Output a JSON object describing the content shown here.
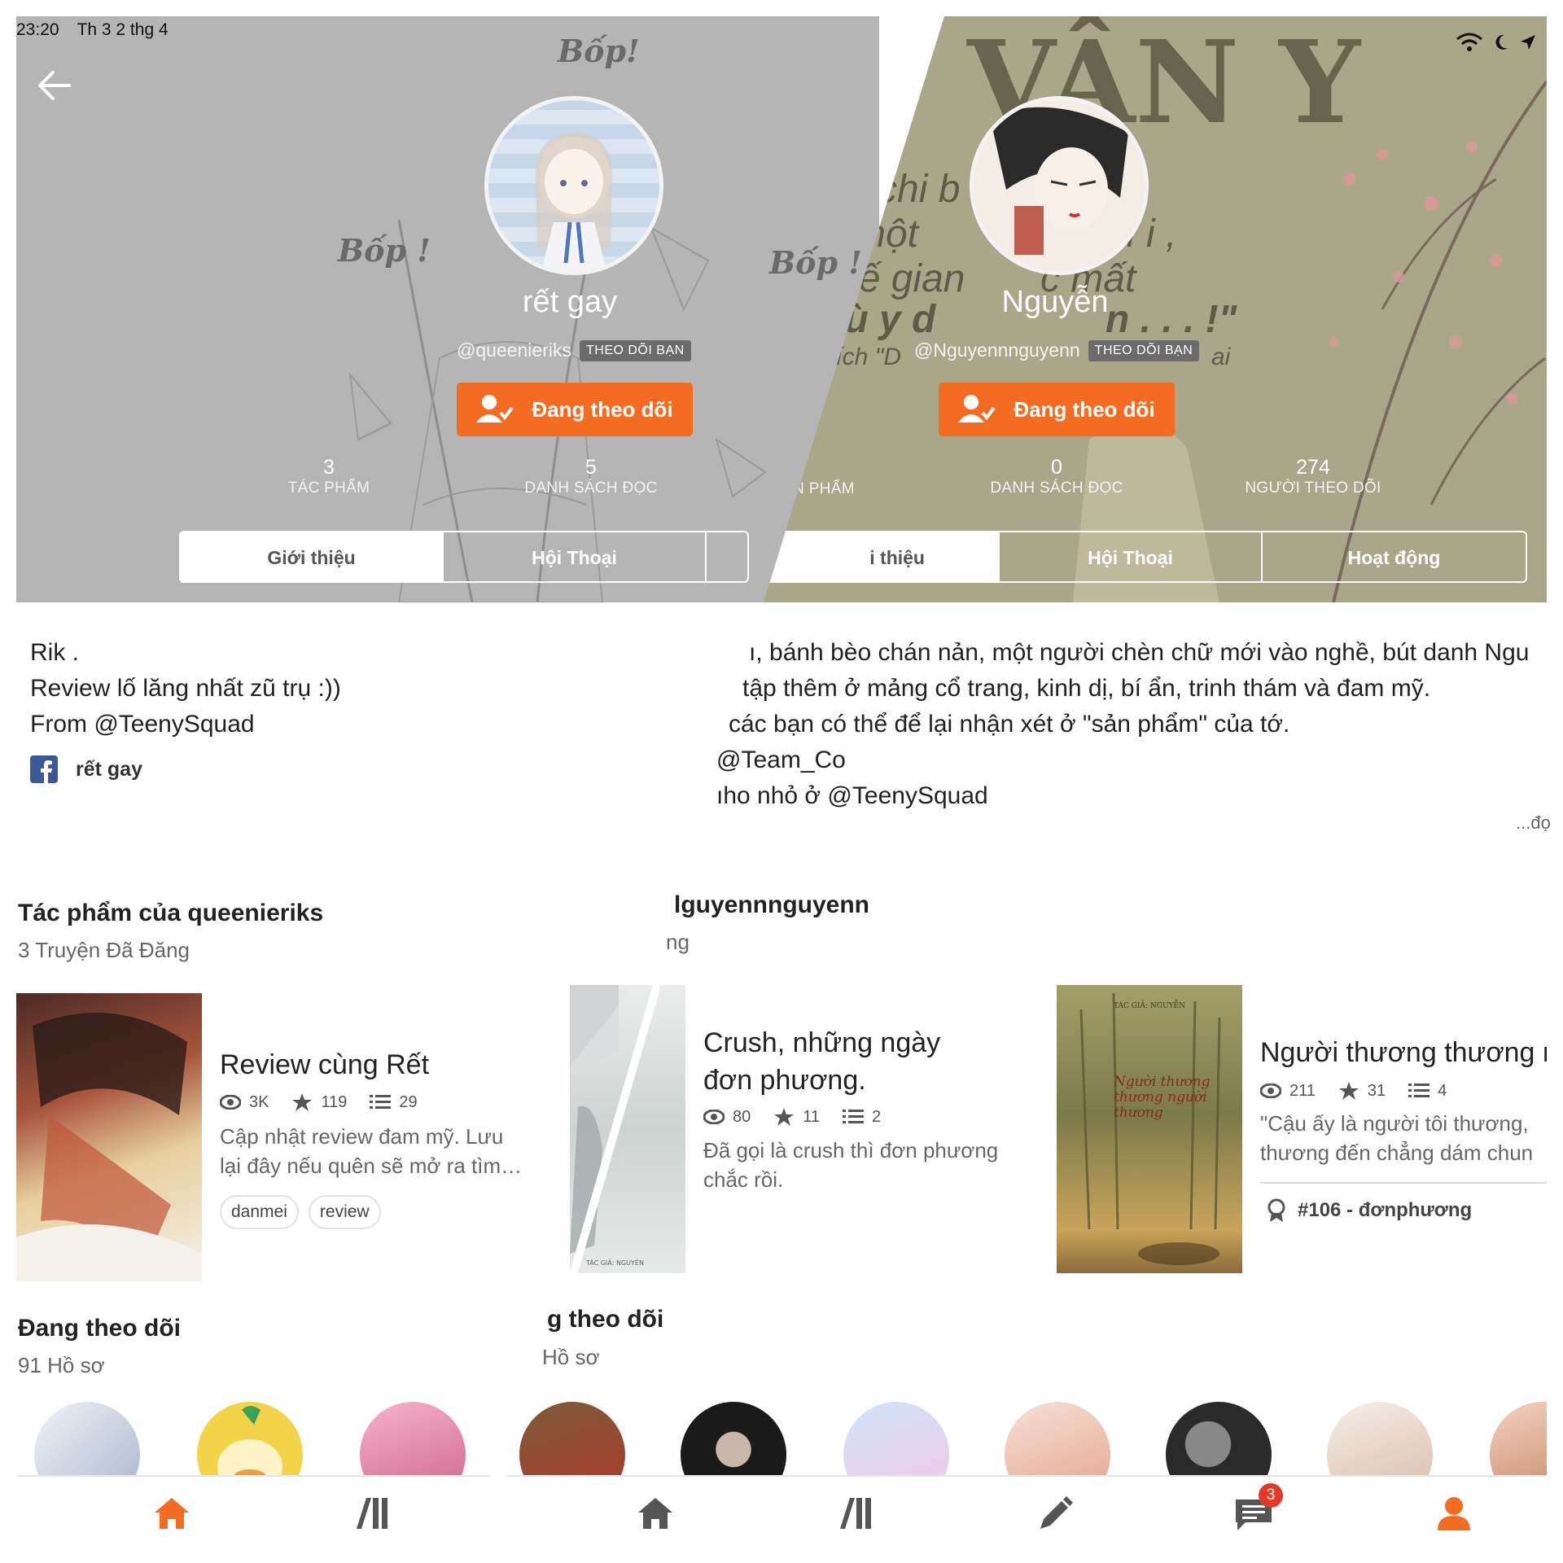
{
  "status_bar": {
    "time": "23:20",
    "date": "Th 3 2 thg 4"
  },
  "left": {
    "header_bg_text": [
      "Bốp!",
      "Bốp !",
      "Bốp !"
    ],
    "display_name": "rết gay",
    "handle": "@queenieriks",
    "badge": "THEO DÕI BẠN",
    "follow_button": "Đang theo dõi",
    "stats": [
      {
        "value": "3",
        "label": "TÁC PHẨM"
      },
      {
        "value": "5",
        "label": "DANH SÁCH ĐỌC"
      }
    ],
    "tabs": [
      "Giới thiệu",
      "Hội Thoại"
    ],
    "bio": [
      "Rik .",
      "Review lố lăng nhất zũ trụ :))",
      "From @TeenySquad"
    ],
    "facebook_name": "rết gay",
    "works_title": "Tác phẩm của queenieriks",
    "works_sub": "3 Truyện Đã Đăng",
    "story": {
      "title": "Review cùng Rết",
      "views": "3K",
      "votes": "119",
      "parts": "29",
      "description": [
        "Cập nhật review đam mỹ. Lưu",
        "lại đây nếu quên sẽ mở ra tìm…"
      ],
      "tags": [
        "danmei",
        "review"
      ]
    },
    "following_title": "Đang theo dõi",
    "following_sub": "91 Hồ sơ"
  },
  "right": {
    "header_bg_text": [
      "VÂN Y",
      "chi b",
      "một",
      "ù i ,",
      "hế gian",
      "c mất",
      "t ù y d",
      "n . . . !\"",
      "trích \"D",
      "ai"
    ],
    "display_name": "Nguyễn",
    "handle": "@Nguyennnguyenn",
    "badge": "THEO DÕI BẠN",
    "follow_button": "Đang theo dõi",
    "stats": [
      {
        "value": "",
        "label": "N  PHẨM"
      },
      {
        "value": "0",
        "label": "DANH SÁCH ĐỌC"
      },
      {
        "value": "274",
        "label": "NGƯỜI THEO DÕI"
      }
    ],
    "tabs": [
      "i thiệu",
      "Hội Thoại",
      "Hoạt động"
    ],
    "bio": [
      "ı, bánh bèo chán nản, một người chèn chữ mới vào nghề, bút danh Ngu",
      "tập thêm ở mảng cổ trang, kinh dị, bí ẩn, trinh thám và đam mỹ.",
      "các bạn có thể để lại nhận xét ở \"sản phẩm\" của tớ.",
      "@Team_Co",
      "ıho nhỏ ở @TeenySquad"
    ],
    "bio_more": "...đọ",
    "works_title": "lguyennnguyenn",
    "works_sub": "ng",
    "story1": {
      "title": [
        "Crush, những ngày",
        "đơn phương."
      ],
      "views": "80",
      "votes": "11",
      "parts": "2",
      "description": [
        "Đã gọi là crush thì đơn phương",
        "chắc rồi."
      ],
      "cover_text": "TÁC GIẢ: NGUYÊN"
    },
    "story2": {
      "title": "Người thương thương n",
      "views": "211",
      "votes": "31",
      "parts": "4",
      "description": [
        "\"Cậu ấy là người tôi thương,",
        "thương đến chẳng dám chun"
      ],
      "rank": "#106 - đơnphương",
      "cover_author": "TÁC GIẢ: NGUYỄN",
      "cover_title": "Người thương thương người thương"
    },
    "following_title": "g theo dõi",
    "following_sub": "Hồ sơ"
  },
  "navbar": {
    "notification_count": "3"
  },
  "colors": {
    "accent": "#f36c21",
    "header_left": "#b5b5b5",
    "header_right": "#a9a68a"
  },
  "icons": [
    "back-arrow-icon",
    "follow-user-icon",
    "eye-icon",
    "star-icon",
    "list-icon",
    "facebook-icon",
    "award-icon",
    "home-icon",
    "library-icon",
    "pencil-icon",
    "messages-icon",
    "profile-icon",
    "wifi-icon"
  ]
}
